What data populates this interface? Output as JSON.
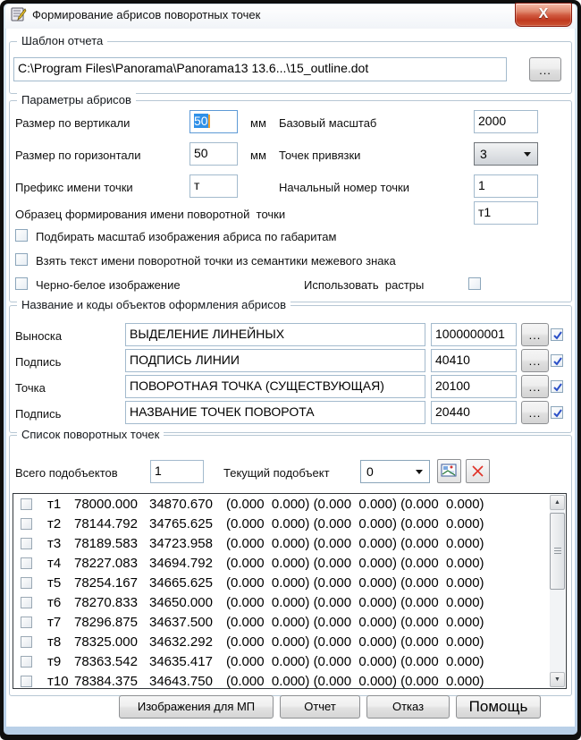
{
  "window": {
    "title": "Формирование абрисов поворотных точек"
  },
  "template": {
    "group_label": "Шаблон отчета",
    "path": "C:\\Program Files\\Panorama\\Panorama13 13.6...\\15_outline.dot",
    "browse": "..."
  },
  "params": {
    "group_label": "Параметры абрисов",
    "size_v_label": "Размер по вертикали",
    "size_v_value": "50",
    "size_v_unit": "мм",
    "base_scale_label": "Базовый масштаб",
    "base_scale_value": "2000",
    "size_h_label": "Размер по горизонтали",
    "size_h_value": "50",
    "size_h_unit": "мм",
    "anchor_label": "Точек привязки",
    "anchor_value": "3",
    "prefix_label": "Префикс имени точки",
    "prefix_value": "т",
    "start_num_label": "Начальный номер точки",
    "start_num_value": "1",
    "sample_label": "Образец формирования имени поворотной  точки",
    "sample_value": "т1",
    "cb_fit_scale": "Подбирать масштаб изображения абриса по габаритам",
    "cb_take_text": "Взять текст имени поворотной точки из семантики межевого знака",
    "cb_bw": "Черно-белое изображение",
    "cb_rasters": "Использовать  растры"
  },
  "objects": {
    "group_label": "Название и коды объектов оформления абрисов",
    "browse": "...",
    "rows": [
      {
        "label": "Выноска",
        "name": "ВЫДЕЛЕНИЕ ЛИНЕЙНЫХ",
        "code": "1000000001"
      },
      {
        "label": "Подпись",
        "name": "ПОДПИСЬ ЛИНИИ",
        "code": "40410"
      },
      {
        "label": "Точка",
        "name": "ПОВОРОТНАЯ ТОЧКА (СУЩЕСТВУЮЩАЯ)",
        "code": "20100"
      },
      {
        "label": "Подпись",
        "name": "НАЗВАНИЕ ТОЧЕК ПОВОРОТА",
        "code": "20440"
      }
    ]
  },
  "points": {
    "group_label": "Список поворотных точек",
    "total_label": "Всего подобъектов",
    "total_value": "1",
    "current_label": "Текущий подобъект",
    "current_value": "0",
    "rows": [
      {
        "name": "т1",
        "x": "78000.000",
        "y": "34870.670",
        "zeros": "(0.000  0.000) (0.000  0.000) (0.000  0.000)"
      },
      {
        "name": "т2",
        "x": "78144.792",
        "y": "34765.625",
        "zeros": "(0.000  0.000) (0.000  0.000) (0.000  0.000)"
      },
      {
        "name": "т3",
        "x": "78189.583",
        "y": "34723.958",
        "zeros": "(0.000  0.000) (0.000  0.000) (0.000  0.000)"
      },
      {
        "name": "т4",
        "x": "78227.083",
        "y": "34694.792",
        "zeros": "(0.000  0.000) (0.000  0.000) (0.000  0.000)"
      },
      {
        "name": "т5",
        "x": "78254.167",
        "y": "34665.625",
        "zeros": "(0.000  0.000) (0.000  0.000) (0.000  0.000)"
      },
      {
        "name": "т6",
        "x": "78270.833",
        "y": "34650.000",
        "zeros": "(0.000  0.000) (0.000  0.000) (0.000  0.000)"
      },
      {
        "name": "т7",
        "x": "78296.875",
        "y": "34637.500",
        "zeros": "(0.000  0.000) (0.000  0.000) (0.000  0.000)"
      },
      {
        "name": "т8",
        "x": "78325.000",
        "y": "34632.292",
        "zeros": "(0.000  0.000) (0.000  0.000) (0.000  0.000)"
      },
      {
        "name": "т9",
        "x": "78363.542",
        "y": "34635.417",
        "zeros": "(0.000  0.000) (0.000  0.000) (0.000  0.000)"
      },
      {
        "name": "т10",
        "x": "78384.375",
        "y": "34643.750",
        "zeros": "(0.000  0.000) (0.000  0.000) (0.000  0.000)"
      }
    ]
  },
  "footer": {
    "images_mp": "Изображения для МП",
    "report": "Отчет",
    "cancel": "Отказ",
    "help": "Помощь"
  }
}
